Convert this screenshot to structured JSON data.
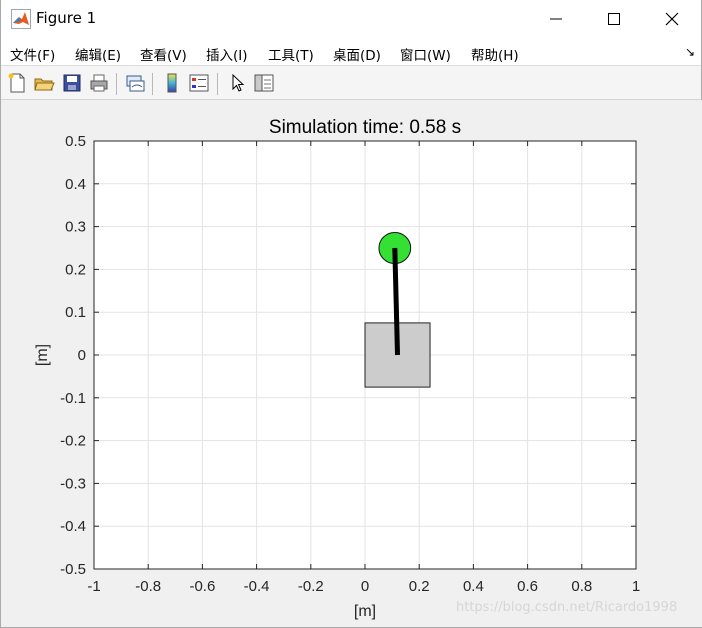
{
  "window": {
    "title": "Figure 1"
  },
  "menu": {
    "items": [
      "文件(F)",
      "编辑(E)",
      "查看(V)",
      "插入(I)",
      "工具(T)",
      "桌面(D)",
      "窗口(W)",
      "帮助(H)"
    ],
    "dock_arrow": "↘"
  },
  "toolbar": {
    "buttons": [
      "new-figure-icon",
      "open-file-icon",
      "save-icon",
      "print-icon",
      "link-plot-icon",
      "colorbar-icon",
      "legend-icon",
      "pointer-icon",
      "property-inspector-icon"
    ]
  },
  "chart_data": {
    "type": "scatter",
    "title": "Simulation time:  0.58 s",
    "xlabel": "[m]",
    "ylabel": "[m]",
    "xlim": [
      -1,
      1
    ],
    "ylim": [
      -0.5,
      0.5
    ],
    "xticks": [
      "-1",
      "-0.8",
      "-0.6",
      "-0.4",
      "-0.2",
      "0",
      "0.2",
      "0.4",
      "0.6",
      "0.8",
      "1"
    ],
    "yticks": [
      "0.5",
      "0.4",
      "0.3",
      "0.2",
      "0.1",
      "0",
      "-0.1",
      "-0.2",
      "-0.3",
      "-0.4",
      "-0.5"
    ],
    "grid": true,
    "cart": {
      "x_min": 0,
      "x_max": 0.24,
      "y_min": -0.075,
      "y_max": 0.075,
      "color": "#cccccc"
    },
    "pole": {
      "x1": 0.12,
      "y1": 0,
      "x2": 0.11,
      "y2": 0.25
    },
    "bob": {
      "x": 0.11,
      "y": 0.25,
      "radius": 0.075,
      "color": "#33e033"
    }
  },
  "watermark": "https://blog.csdn.net/Ricardo1998"
}
